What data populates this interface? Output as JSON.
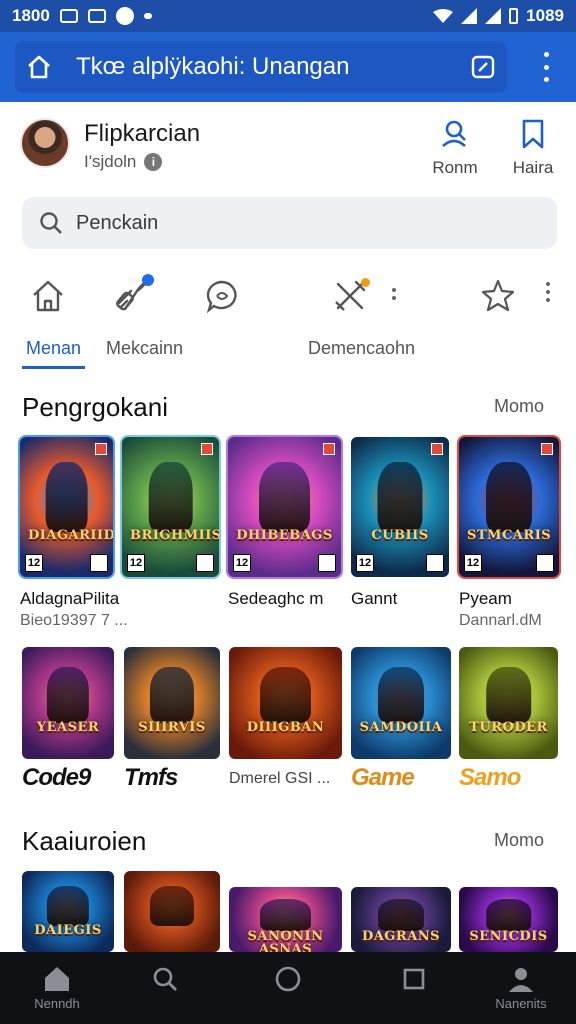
{
  "status_bar": {
    "time": "1800",
    "clock": "1089"
  },
  "browser": {
    "title": "Tkœ alplÿkaohi: Unangan"
  },
  "profile": {
    "name": "Flipkarcian",
    "subtitle": "I'sjdoln",
    "actions": [
      {
        "label": "Ronm",
        "icon": "person-icon"
      },
      {
        "label": "Haira",
        "icon": "bookmark-icon"
      }
    ]
  },
  "search": {
    "placeholder": "Penckain"
  },
  "nav": {
    "tabs": [
      {
        "label": "Menan",
        "icon": "home-icon",
        "active": true
      },
      {
        "label": "Mekcainn",
        "icon": "rocket-icon",
        "badge": true
      },
      {
        "label": "",
        "icon": "chat-icon"
      },
      {
        "label": "Demencaohn",
        "icon": "tools-icon",
        "badge": true
      },
      {
        "label": "",
        "icon": "star-icon"
      }
    ]
  },
  "section1": {
    "title": "Pengrgokani",
    "more": "Momo",
    "row1": [
      {
        "art_title": "DIAGARIIDIS",
        "caption": "AldagnaPilita",
        "sub": "Bieo19397 7 ...",
        "colors": [
          "#1b2a6b",
          "#e85a2c",
          "#2aa0ff"
        ]
      },
      {
        "art_title": "BRIGHMIIS",
        "caption": "",
        "sub": "",
        "colors": [
          "#1a4b3a",
          "#5ea24a",
          "#d6e06a"
        ]
      },
      {
        "art_title": "DHIBEBAGS",
        "caption": "Sedeaghc m",
        "sub": "",
        "colors": [
          "#5b2b8a",
          "#d64cbf",
          "#f2a34c"
        ]
      },
      {
        "art_title": "CUBIIS",
        "caption": "Gannt",
        "sub": "",
        "colors": [
          "#0d2a4a",
          "#1a8fb8",
          "#f2a23c"
        ]
      },
      {
        "art_title": "STMCARIS",
        "caption": "Pyeam",
        "sub": "Dannarl.dM",
        "colors": [
          "#12163a",
          "#2c6bd8",
          "#e23a2a"
        ]
      }
    ],
    "row2": [
      {
        "art_title": "YEASER",
        "logo": "Code9",
        "logo_color": "#111111",
        "colors": [
          "#3a1a5a",
          "#b23a8a",
          "#f2a23c"
        ]
      },
      {
        "art_title": "SIIIRVIS",
        "logo": "Tmfs",
        "logo_color": "#111111",
        "colors": [
          "#2b2f3a",
          "#d27a2a",
          "#f3c06a"
        ]
      },
      {
        "art_title": "DIIIGBAN",
        "caption": "Dmerel GSI ...",
        "colors": [
          "#6a1a0a",
          "#d2541a",
          "#f6c24a"
        ]
      },
      {
        "art_title": "SAMDOIIA",
        "logo": "Game",
        "logo_color": "#e08a1a",
        "colors": [
          "#0d3a6a",
          "#2a8ed2",
          "#e85a2a"
        ]
      },
      {
        "art_title": "TURODER",
        "logo": "Samo",
        "logo_color": "#f0a020",
        "colors": [
          "#4a5a10",
          "#a8c23a",
          "#f2d25a"
        ]
      }
    ]
  },
  "section2": {
    "title": "Kaaiuroien",
    "more": "Momo",
    "row": [
      {
        "art_title": "DAIEGIS",
        "colors": [
          "#0d2a5a",
          "#1a7ac8",
          "#f2a23c"
        ]
      },
      {
        "art_title": "",
        "colors": [
          "#5a1a0a",
          "#c24a1a",
          "#f2a24a"
        ]
      },
      {
        "art_title": "SANONIN ASNAS",
        "colors": [
          "#4a1a6a",
          "#d2468a",
          "#f6c24a"
        ]
      },
      {
        "art_title": "DAGRANS",
        "colors": [
          "#1a1a3a",
          "#5a3a8a",
          "#e24a2a"
        ]
      },
      {
        "art_title": "SENICDIS",
        "colors": [
          "#2a0a4a",
          "#8a2ac8",
          "#f2c24a"
        ]
      }
    ]
  },
  "bottom_nav": [
    {
      "label": "Nenndh",
      "icon": "home-icon"
    },
    {
      "label": "",
      "icon": "search-icon"
    },
    {
      "label": "",
      "icon": "circle-icon"
    },
    {
      "label": "",
      "icon": "square-icon"
    },
    {
      "label": "Nanenits",
      "icon": "person-icon"
    }
  ]
}
